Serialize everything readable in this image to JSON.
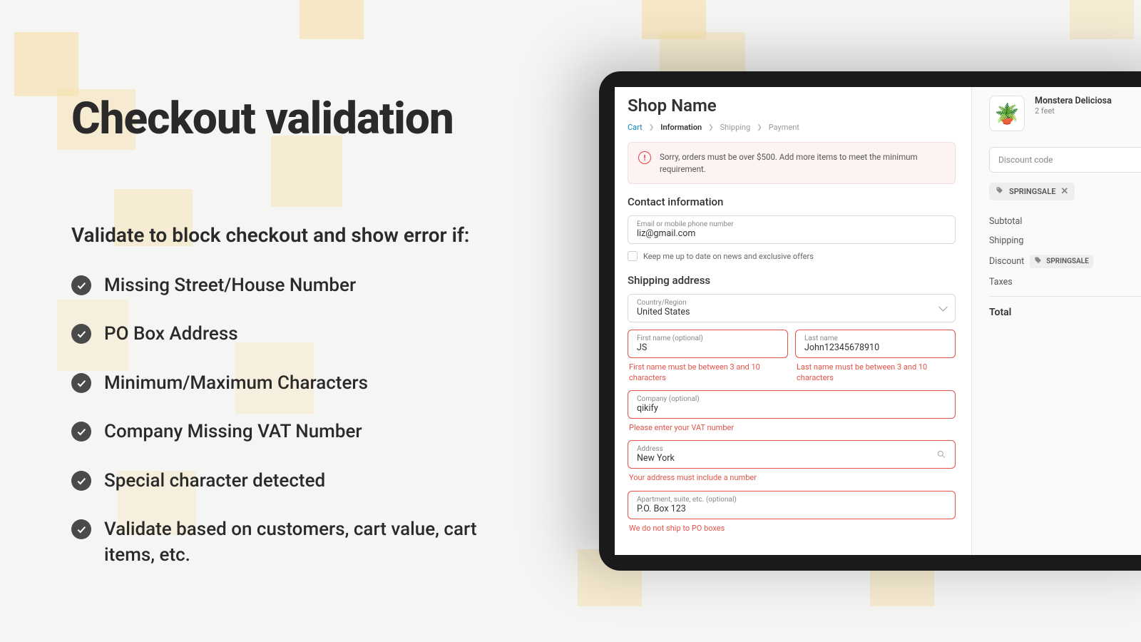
{
  "hero": {
    "title": "Checkout validation",
    "subtitle": "Validate to block checkout and show error if:",
    "features": [
      "Missing Street/House Number",
      "PO Box Address",
      "Minimum/Maximum Characters",
      "Company Missing VAT Number",
      "Special character detected",
      "Validate based on customers, cart value, cart items, etc."
    ]
  },
  "checkout": {
    "shop_name": "Shop Name",
    "breadcrumb": {
      "cart": "Cart",
      "information": "Information",
      "shipping": "Shipping",
      "payment": "Payment"
    },
    "banner_error": "Sorry, orders must be over $500. Add more items to meet the minimum requirement.",
    "contact": {
      "heading": "Contact information",
      "email_label": "Email or mobile phone number",
      "email_value": "liz@gmail.com",
      "news_optin": "Keep me up to date on news and exclusive offers"
    },
    "shipping": {
      "heading": "Shipping address",
      "country_label": "Country/Region",
      "country_value": "United States",
      "first_name_label": "First name (optional)",
      "first_name_value": "JS",
      "first_name_error": "First name must be between 3 and 10 characters",
      "last_name_label": "Last name",
      "last_name_value": "John12345678910",
      "last_name_error": "Last name must be between 3 and 10 characters",
      "company_label": "Company (optional)",
      "company_value": "qikify",
      "company_error": "Please enter your VAT number",
      "address_label": "Address",
      "address_value": "New York",
      "address_error": "Your address must include a number",
      "apartment_label": "Apartment, suite, etc. (optional)",
      "apartment_value": "P.O. Box 123",
      "apartment_error": "We do not ship to PO boxes"
    }
  },
  "cart": {
    "product_name": "Monstera Deliciosa",
    "product_variant": "2 feet",
    "discount_placeholder": "Discount code",
    "applied_code": "SPRINGSALE",
    "summary": {
      "subtotal_label": "Subtotal",
      "shipping_label": "Shipping",
      "discount_label": "Discount",
      "taxes_label": "Taxes",
      "total_label": "Total"
    }
  }
}
